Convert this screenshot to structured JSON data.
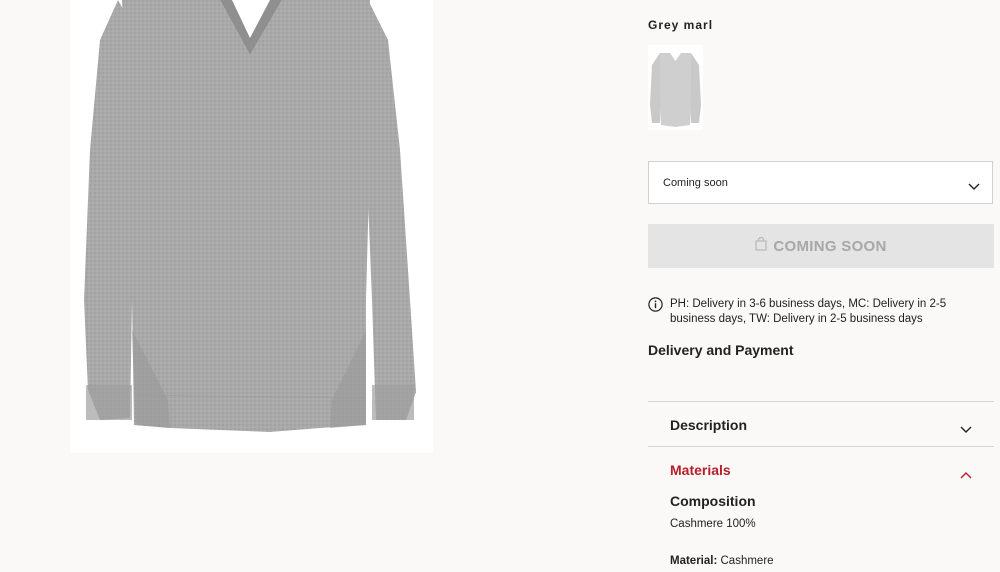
{
  "product": {
    "color_name": "Grey marl",
    "swatch_selected": true
  },
  "size_select": {
    "value": "Coming soon"
  },
  "add_button": {
    "label": "COMING SOON",
    "icon": "shopping-bag-icon"
  },
  "delivery_note": {
    "icon": "info-icon",
    "text": "PH: Delivery in 3-6 business days, MC: Delivery in 2-5 business days, TW: Delivery in 2-5 business days"
  },
  "delivery_link": "Delivery and Payment",
  "accordion": [
    {
      "title": "Description",
      "expanded": false
    },
    {
      "title": "Materials",
      "expanded": true
    }
  ],
  "materials": {
    "composition_heading": "Composition",
    "composition_value": "Cashmere 100%",
    "material_label": "Material:",
    "material_value": "Cashmere"
  },
  "colors": {
    "accent_red": "#b5202a",
    "button_disabled_bg": "#e4e4e4",
    "button_disabled_text": "#a7a7a7",
    "page_bg": "#faf9f8",
    "sweater_grey": "#a6a6a6"
  }
}
